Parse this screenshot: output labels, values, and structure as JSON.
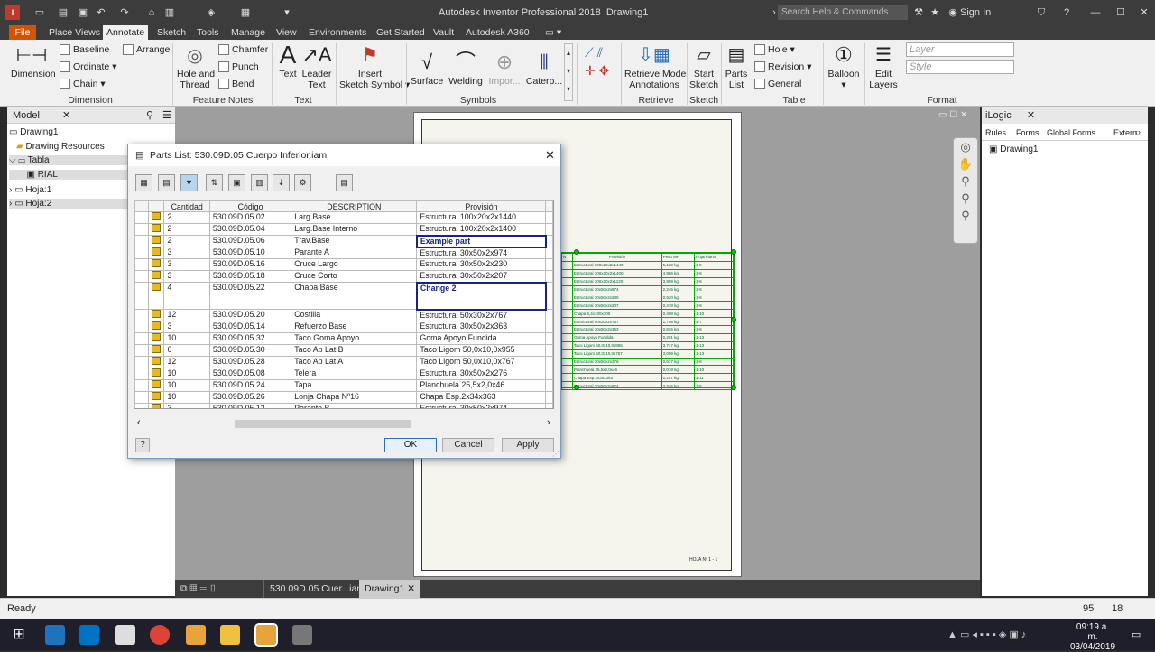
{
  "app": {
    "title": "Autodesk Inventor Professional 2018",
    "document": "Drawing1",
    "search_placeholder": "Search Help & Commands...",
    "sign_in": "Sign In"
  },
  "ribbon_tabs": [
    "File",
    "Place Views",
    "Annotate",
    "Sketch",
    "Tools",
    "Manage",
    "View",
    "Environments",
    "Get Started",
    "Vault",
    "Autodesk A360"
  ],
  "ribbon": {
    "dimension": "Dimension",
    "baseline": "Baseline",
    "ordinate": "Ordinate",
    "chain": "Chain",
    "arrange": "Arrange",
    "hole_thread": [
      "Hole and",
      "Thread"
    ],
    "chamfer": "Chamfer",
    "punch": "Punch",
    "bend": "Bend",
    "text": "Text",
    "leader_text": [
      "Leader",
      "Text"
    ],
    "insert_sketch_symbol": [
      "Insert",
      "Sketch Symbol"
    ],
    "surface": "Surface",
    "welding": "Welding",
    "import": "Impor...",
    "caterpillar": "Caterp...",
    "retrieve_model": [
      "Retrieve Model",
      "Annotations"
    ],
    "start_sketch": [
      "Start",
      "Sketch"
    ],
    "parts_list": [
      "Parts",
      "List"
    ],
    "hole": "Hole",
    "revision": "Revision",
    "general": "General",
    "balloon": "Balloon",
    "edit_layers": [
      "Edit",
      "Layers"
    ],
    "layer_placeholder": "Layer",
    "style_placeholder": "Style",
    "groups": [
      "Dimension",
      "Feature Notes",
      "Text",
      "Symbols",
      "Retrieve",
      "Sketch",
      "Table",
      "Format"
    ]
  },
  "left_panel": {
    "tab": "Model",
    "tree": [
      "Drawing1",
      "Drawing Resources",
      "Tabla",
      "RIAL",
      "Hoja:1",
      "Hoja:2"
    ]
  },
  "right_panel": {
    "tab": "iLogic",
    "subtabs": [
      "Rules",
      "Forms",
      "Global Forms",
      "Extern"
    ],
    "item": "Drawing1"
  },
  "bottom_tabs": [
    "530.09D.05 Cuer...iam",
    "Drawing1"
  ],
  "status": {
    "text": "Ready",
    "n1": "95",
    "n2": "18"
  },
  "taskbar": {
    "time": "09:19 a. m.",
    "date": "03/04/2019"
  },
  "sheet": {
    "label": "HOJA Nº 1 - 1"
  },
  "sheet_table": {
    "headers": [
      "N",
      "Provisión",
      "Peso MP",
      "Hoja/Plano"
    ],
    "rows": [
      [
        "Estructural 100x20x2x1440",
        "5,129 kg",
        "1-5"
      ],
      [
        "Estructural 100x20x2x1400",
        "4,986 kg",
        "1-5"
      ],
      [
        "Estructural 100x20x2x1120",
        "3,989 kg",
        "1-5"
      ],
      [
        "Estructural 30x50x2x974",
        "2,245 kg",
        "1-5"
      ],
      [
        "Estructural 30x50x2x230",
        "0,530 kg",
        "1-5"
      ],
      [
        "Estructural 30x50x2x207",
        "0,478 kg",
        "1-5"
      ],
      [
        "Chapa 6,4x100x100",
        "0,498 kg",
        "1-10"
      ],
      [
        "Estructural 50x30x2x767",
        "1,768 kg",
        "1-7"
      ],
      [
        "Estructural 30x50x2x363",
        "0,836 kg",
        "1-5"
      ],
      [
        "Goma Apoyo Fundida",
        "0,201 kg",
        "1-13"
      ],
      [
        "Taco Ligom 50,0x10,0x955",
        "3,747 kg",
        "1-13"
      ],
      [
        "Taco Ligom 50,0x10,0x767",
        "3,009 kg",
        "1-13"
      ],
      [
        "Estructural 30x50x2x276",
        "0,637 kg",
        "1-5"
      ],
      [
        "Planchuela 25,5x2,0x46",
        "0,018 kg",
        "1-10"
      ],
      [
        "Chapa Esp.2x34x363",
        "0,157 kg",
        "1-11"
      ],
      [
        "Estructural 30x50x2x974",
        "2,245 kg",
        "1-5"
      ]
    ]
  },
  "dialog": {
    "title": "Parts List: 530.09D.05 Cuerpo Inferior.iam",
    "columns": [
      "Cantidad",
      "Código",
      "DESCRIPTION",
      "Provisión"
    ],
    "rows": [
      [
        "2",
        "530.09D.05.02",
        "Larg.Base",
        "Estructural 100x20x2x1440"
      ],
      [
        "2",
        "530.09D.05.04",
        "Larg.Base Interno",
        "Estructural 100x20x2x1400"
      ],
      [
        "2",
        "530.09D.05.06",
        "Trav.Base",
        "Example part"
      ],
      [
        "3",
        "530.09D.05.10",
        "Parante A",
        "Estructural 30x50x2x974"
      ],
      [
        "3",
        "530.09D.05.16",
        "Cruce Largo",
        "Estructural 30x50x2x230"
      ],
      [
        "3",
        "530.09D.05.18",
        "Cruce Corto",
        "Estructural 30x50x2x207"
      ],
      [
        "4",
        "530.09D.05.22",
        "Chapa Base",
        "Change 2"
      ],
      [
        "12",
        "530.09D.05.20",
        "Costilla",
        "Estructural 50x30x2x767"
      ],
      [
        "3",
        "530.09D.05.14",
        "Refuerzo Base",
        "Estructural 30x50x2x363"
      ],
      [
        "10",
        "530.09D.05.32",
        "Taco Goma Apoyo",
        "Goma Apoyo Fundida"
      ],
      [
        "6",
        "530.09D.05.30",
        "Taco Ap Lat B",
        "Taco Ligom 50,0x10,0x955"
      ],
      [
        "12",
        "530.09D.05.28",
        "Taco Ap Lat A",
        "Taco Ligom 50,0x10,0x767"
      ],
      [
        "10",
        "530.09D.05.08",
        "Telera",
        "Estructural 30x50x2x276"
      ],
      [
        "10",
        "530.09D.05.24",
        "Tapa",
        "Planchuela 25,5x2,0x46"
      ],
      [
        "10",
        "530.09D.05.26",
        "Lonja Chapa Nº16",
        "Chapa Esp.2x34x363"
      ],
      [
        "3",
        "530.09D.05.12",
        "Parante B",
        "Estructural 30x50x2x974"
      ]
    ],
    "help": "?",
    "ok": "OK",
    "cancel": "Cancel",
    "apply": "Apply"
  }
}
